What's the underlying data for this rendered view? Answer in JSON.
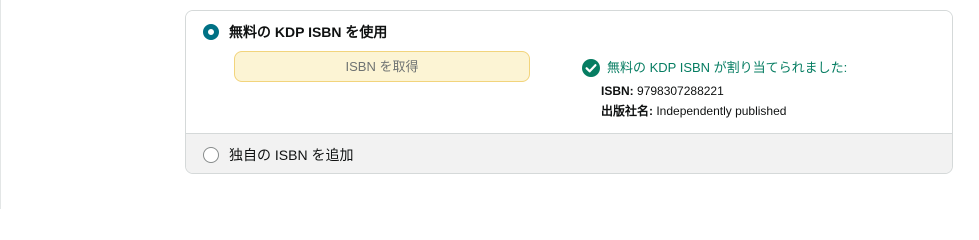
{
  "isbn_section": {
    "free_option": {
      "label": "無料の KDP ISBN を使用",
      "selected": true,
      "get_isbn_button": "ISBN を取得",
      "status_message": "無料の KDP ISBN が割り当てられました:",
      "isbn_label": "ISBN:",
      "isbn_value": "9798307288221",
      "publisher_label": "出版社名:",
      "publisher_value": "Independently published"
    },
    "own_option": {
      "label": "独自の ISBN を追加",
      "selected": false
    }
  },
  "colors": {
    "accent_teal": "#007185",
    "success_green": "#067d62",
    "button_bg": "#fcf4d4",
    "button_border": "#f2d47c",
    "unselected_bg": "#f2f2f2"
  },
  "icons": {
    "status": "check-circle-icon"
  }
}
